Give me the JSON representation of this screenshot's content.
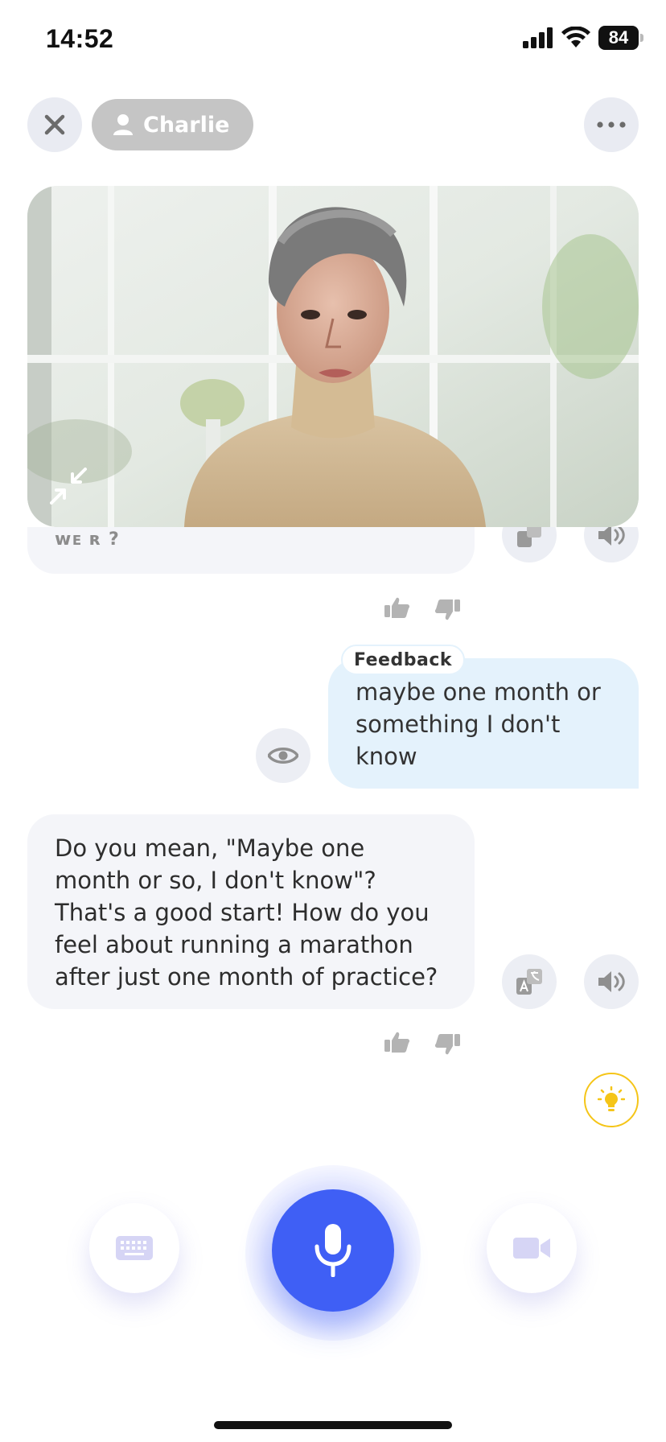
{
  "status_bar": {
    "time": "14:52",
    "battery": "84"
  },
  "header": {
    "contact_name": "Charlie"
  },
  "chat": {
    "previous_ai_fragment": "ᴡᴇ ʀ ?",
    "user_message": {
      "tag": "Feedback",
      "text": "maybe one month or something I don't know"
    },
    "ai_message": {
      "text": "Do you mean, \"Maybe one month or so, I don't know\"? That's a good start! How do you feel about running a marathon after just one month of practice?"
    }
  },
  "icons": {
    "close": "close-icon",
    "person": "person-icon",
    "more": "more-icon",
    "collapse": "collapse-icon",
    "translate": "translate-icon",
    "speaker": "speaker-icon",
    "thumbs_up": "thumbs-up-icon",
    "thumbs_down": "thumbs-down-icon",
    "eye": "eye-icon",
    "hint": "lightbulb-icon",
    "keyboard": "keyboard-icon",
    "microphone": "microphone-icon",
    "camera": "video-camera-icon"
  },
  "colors": {
    "accent": "#3f5ff5",
    "user_bubble": "#e4f2fc",
    "ai_bubble": "#f4f5f9",
    "hint": "#f5c518",
    "chip": "#c5c5c5"
  }
}
